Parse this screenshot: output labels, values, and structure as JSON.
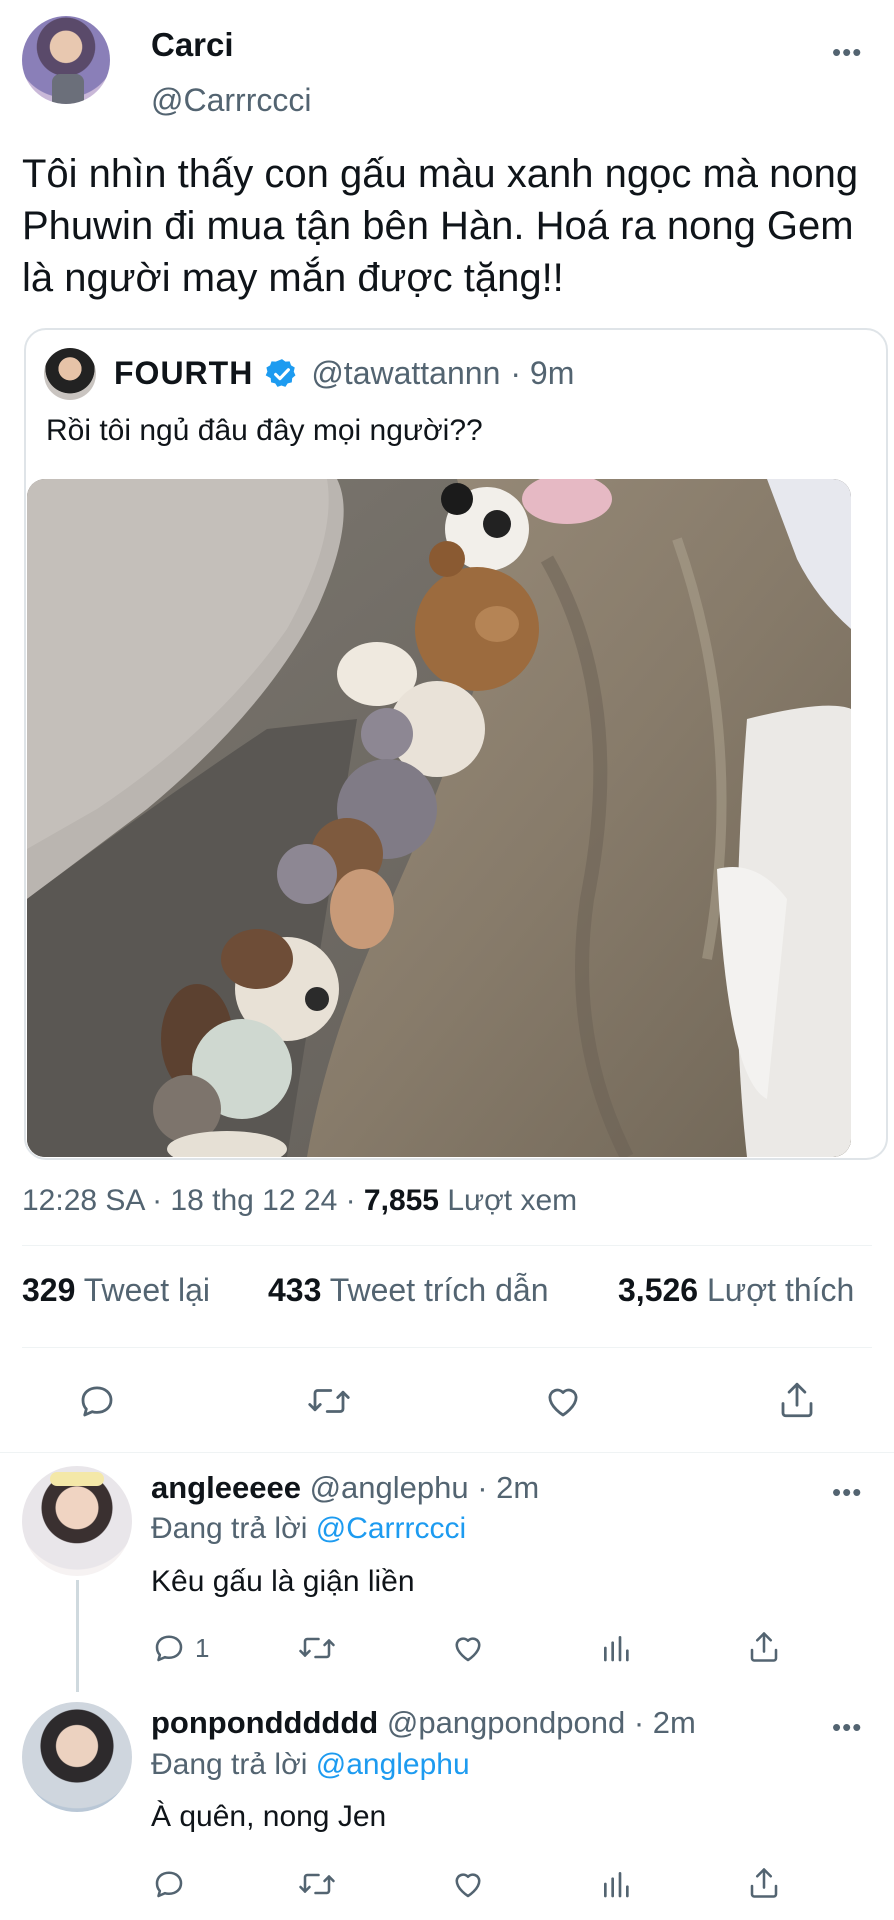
{
  "tweet": {
    "author_name": "Carci",
    "author_handle": "@Carrrccci",
    "text": "Tôi nhìn thấy con gấu màu xanh ngọc mà nong Phuwin đi mua tận bên Hàn. Hoá ra nong Gem là người may mắn được tặng!!",
    "meta_time": "12:28 SA · 18 thg 12 24 · ",
    "views_count": "7,855",
    "views_label": "Lượt xem",
    "retweets_count": "329",
    "retweets_label": "Tweet lại",
    "quotes_count": "433",
    "quotes_label": "Tweet trích dẫn",
    "likes_count": "3,526",
    "likes_label": "Lượt thích"
  },
  "quoted": {
    "author_name": "FOURTH",
    "author_handle": "@tawattannn",
    "time": "· 9m",
    "text": "Rồi tôi ngủ đâu đây mọi người??"
  },
  "replies": [
    {
      "author_name": "angleeeee",
      "author_handle": "@anglephu",
      "time": "· 2m",
      "replying_label": "Đang trả lời",
      "replying_to": "@Carrrccci",
      "text": "Kêu gấu là giận liền",
      "reply_count": "1"
    },
    {
      "author_name": "ponpondddddd",
      "author_handle": "@pangpondpond",
      "time": "· 2m",
      "replying_label": "Đang trả lời",
      "replying_to": "@anglephu",
      "text": "À quên, nong Jen",
      "reply_count": ""
    }
  ],
  "icons": [
    "more-icon",
    "verified-icon",
    "reply-icon",
    "retweet-icon",
    "like-icon",
    "share-icon",
    "analytics-icon"
  ],
  "colors": {
    "accent": "#1d9bf0",
    "muted": "#536471",
    "text": "#0f1419"
  }
}
